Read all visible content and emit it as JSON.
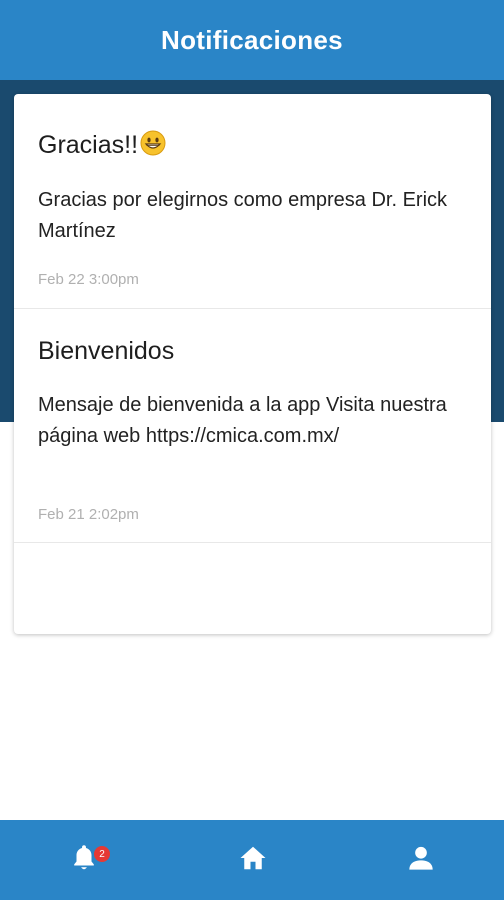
{
  "header": {
    "title": "Notificaciones"
  },
  "notifications": [
    {
      "title": "Gracias!!",
      "emoji": "grinning-face-emoji",
      "body": "Gracias por elegirnos como empresa Dr. Erick Martínez",
      "time": "Feb 22 3:00pm"
    },
    {
      "title": "Bienvenidos",
      "body": "Mensaje de bienvenida a la app Visita nuestra página web https://cmica.com.mx/",
      "time": "Feb 21 2:02pm"
    }
  ],
  "bottom_nav": {
    "items": [
      {
        "icon": "bell-icon",
        "badge": "2"
      },
      {
        "icon": "home-icon"
      },
      {
        "icon": "person-icon"
      }
    ]
  },
  "colors": {
    "primary": "#2a85c7",
    "dark_band": "#1a4a6e",
    "badge": "#e53935"
  }
}
